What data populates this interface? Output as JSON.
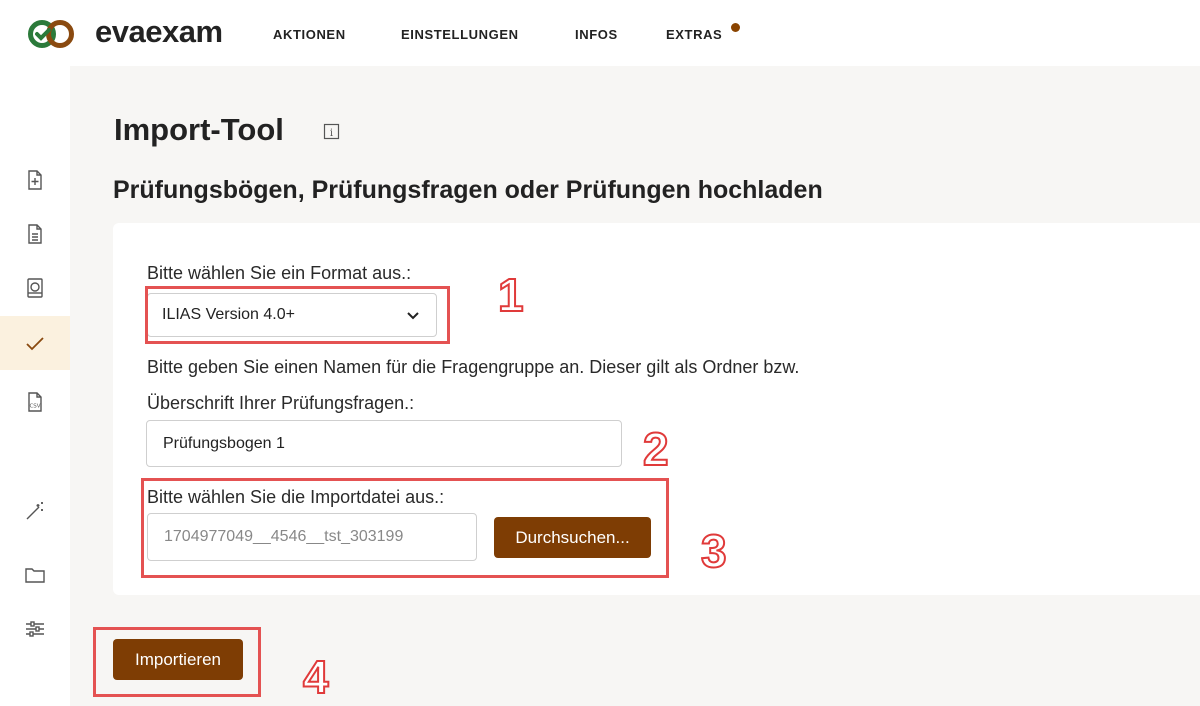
{
  "app": {
    "name": "evaexam"
  },
  "nav": [
    {
      "label": "AKTIONEN"
    },
    {
      "label": "EINSTELLUNGEN"
    },
    {
      "label": "INFOS"
    },
    {
      "label": "EXTRAS"
    }
  ],
  "sidebar": {
    "items": [
      {
        "icon": "file-plus-icon"
      },
      {
        "icon": "document-icon"
      },
      {
        "icon": "book-icon"
      },
      {
        "icon": "checkmark-icon",
        "active": true
      },
      {
        "icon": "csv-icon"
      },
      {
        "icon": "magic-wand-icon"
      },
      {
        "icon": "folder-icon"
      },
      {
        "icon": "sliders-icon"
      }
    ]
  },
  "page": {
    "title": "Import-Tool",
    "subtitle": "Prüfungsbögen, Prüfungsfragen oder Prüfungen hochladen"
  },
  "form": {
    "format_label": "Bitte wählen Sie ein Format aus.:",
    "format_value": "ILIAS Version 4.0+",
    "group_label_line1": "Bitte geben Sie einen Namen für die Fragengruppe an. Dieser gilt als Ordner bzw.",
    "group_label_line2": "Überschrift Ihrer Prüfungsfragen.:",
    "group_value": "Prüfungsbogen 1",
    "file_label": "Bitte wählen Sie die Importdatei aus.:",
    "file_value": "1704977049__4546__tst_303199",
    "browse_label": "Durchsuchen...",
    "import_label": "Importieren"
  },
  "annotations": [
    "1",
    "2",
    "3",
    "4"
  ],
  "colors": {
    "accent": "#7e3d04",
    "annotation": "#e45252",
    "active_bg": "#fbf1df"
  }
}
